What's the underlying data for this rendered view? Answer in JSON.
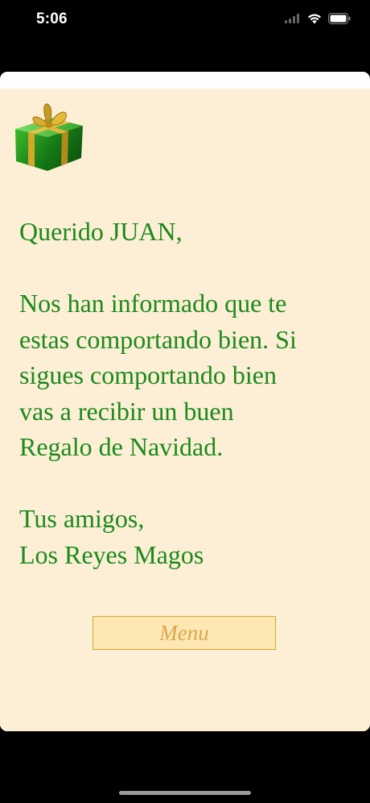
{
  "status_bar": {
    "time": "5:06",
    "icons": [
      "signal-icon",
      "wifi-icon",
      "battery-icon"
    ]
  },
  "letter": {
    "greeting": "Querido JUAN,",
    "body_lines": [
      "Nos han informado que te",
      "estas comportando bien. Si",
      "sigues comportando bien",
      "vas a recibir un buen",
      "Regalo de Navidad."
    ],
    "closing": "Tus amigos,",
    "signature": "Los Reyes Magos"
  },
  "menu_button": {
    "label": "Menu"
  },
  "colors": {
    "background": "#fdefd6",
    "text": "#1a8a1a",
    "button_fill": "#fde7b3",
    "button_border": "#d9a52c",
    "button_text": "#dca84a"
  }
}
